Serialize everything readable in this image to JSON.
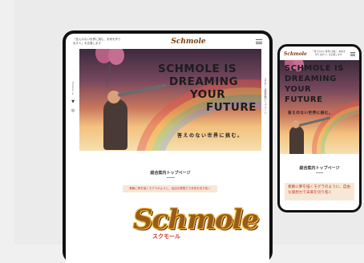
{
  "site": {
    "tagline": "「答えのない世界に挑む、未来を作り出す人」を応援します",
    "logo_text": "Schmole",
    "logo_kana": "スクモール"
  },
  "hero": {
    "headline_lines": [
      "SCHMOLE IS",
      "DREAMING",
      "YOUR",
      "FUTURE"
    ],
    "subtitle": "答えのない世界に挑む。"
  },
  "side": {
    "follow_label": "Follow us",
    "vertical_right": "スクモール総合案内トップページ"
  },
  "section": {
    "title": "総合案内トップページ",
    "pill_text": "素敵に夢を描くモグラのように、自由な発想力で未来を切り拓く",
    "pill_text_phone": "素敵に夢を描くモグラのように、自由な発想力で未来を切り拓く"
  },
  "icons": {
    "social_1": "twitter-icon",
    "social_2": "instagram-icon"
  },
  "colors": {
    "logo_brown": "#9a5a18",
    "accent_red": "#c0392b",
    "pill_bg": "#f7e7d6",
    "device_frame": "#111111"
  }
}
